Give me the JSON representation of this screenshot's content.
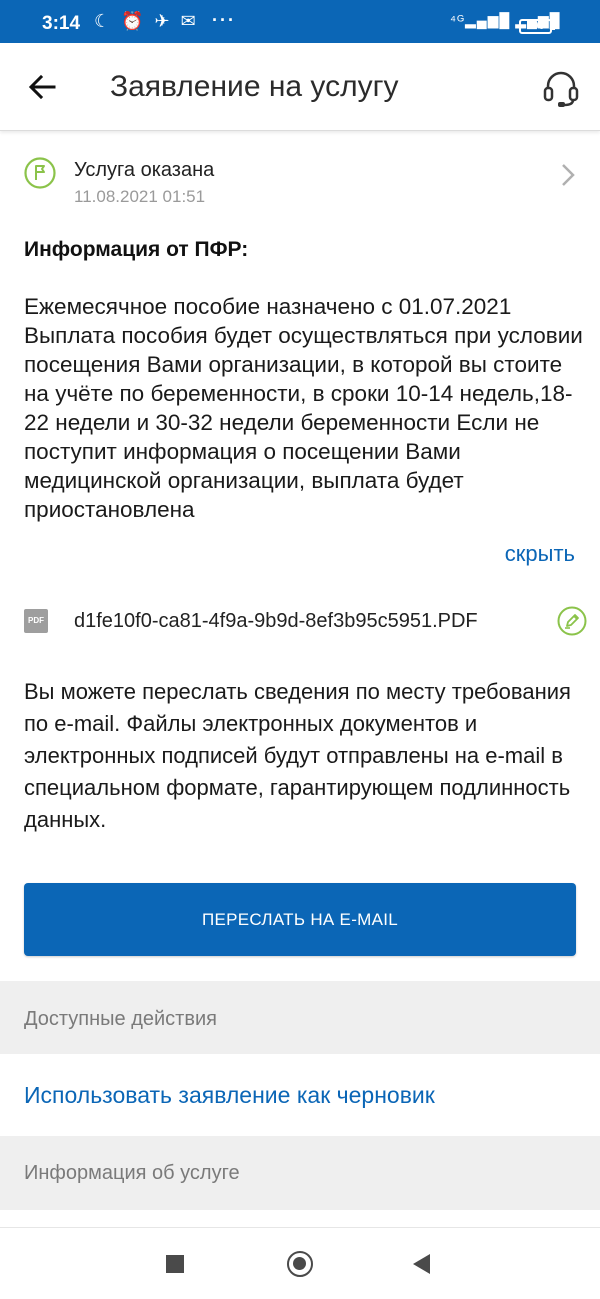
{
  "status_bar": {
    "time": "3:14",
    "left_icons": "☾ ⏰ ✈ ✉",
    "dots": "···",
    "signal": "⁴ᴳ▂▄▆█ ▂▄▆█",
    "battery": "100"
  },
  "header": {
    "title": "Заявление на услугу",
    "back_icon": "arrow-left-icon",
    "support_icon": "headset-icon"
  },
  "service_status": {
    "label": "Услуга оказана",
    "date": "11.08.2021 01:51",
    "icon": "flag-icon",
    "accent": "#8bc34a"
  },
  "info": {
    "heading": "Информация от ПФР:",
    "text": "Ежемесячное пособие назначено с 01.07.2021 Выплата пособия будет осуществляться при условии посещения Вами организации, в которой вы стоите на учёте по беременности, в сроки 10-14 недель,18-22 недели и 30-32 недели беременности Если не поступит информация о посещении Вами медицинской организации, выплата будет приостановлена",
    "hide_label": "скрыть"
  },
  "file": {
    "badge": "PDF",
    "name": "d1fe10f0-ca81-4f9a-9b9d-8ef3b95c5951.PDF"
  },
  "email_info": {
    "text": "Вы можете переслать сведения по месту требования по e-mail. Файлы электронных документов и электронных подписей будут отправлены на e-mail в специальном формате, гарантирующем подлинность данных.",
    "button_label": "ПЕРЕСЛАТЬ НА E-MAIL"
  },
  "actions": {
    "section_label": "Доступные действия",
    "draft_link": "Использовать заявление как черновик"
  },
  "service_info": {
    "section_label": "Информация об услуге"
  },
  "colors": {
    "brand": "#0b66b6",
    "status_green": "#8bc34a",
    "section_bg": "#efefef"
  }
}
